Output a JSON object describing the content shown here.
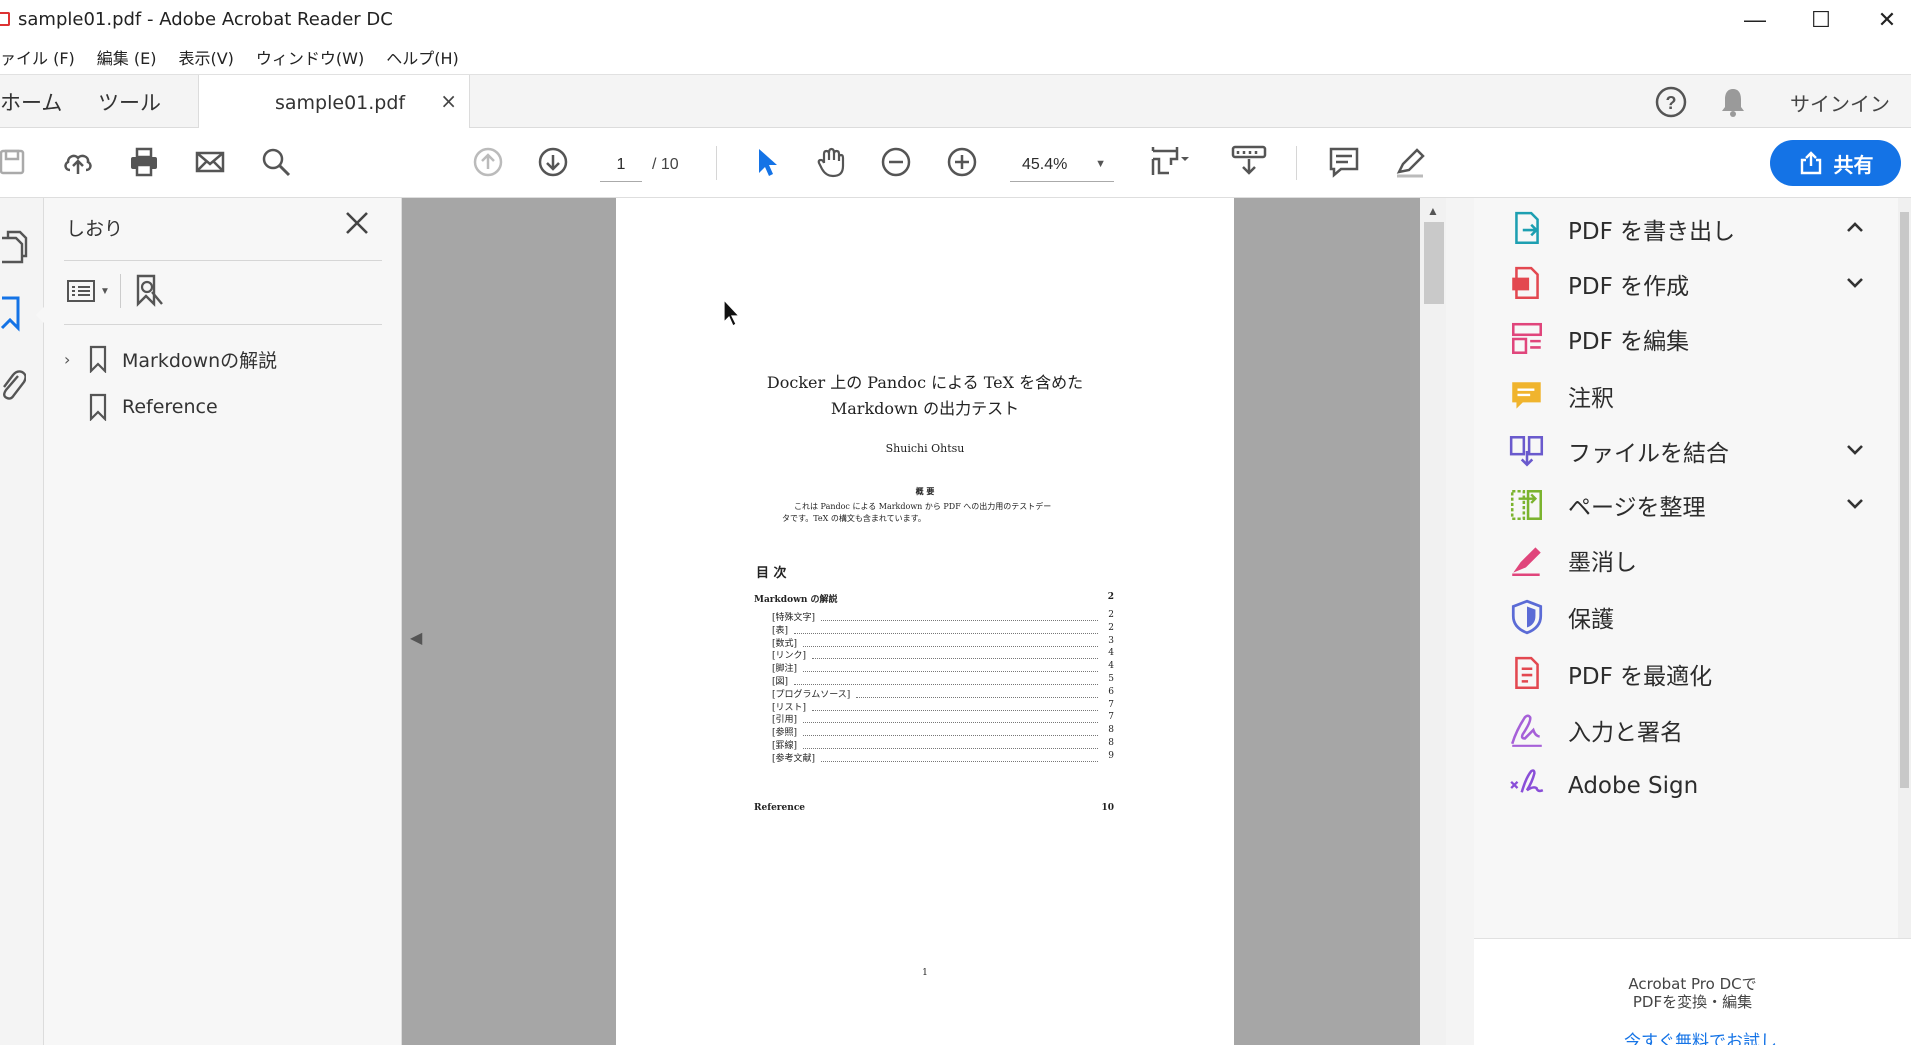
{
  "window": {
    "title": "sample01.pdf - Adobe Acrobat Reader DC",
    "minimize": "—",
    "maximize": "☐",
    "close": "✕"
  },
  "menu": [
    "ァイル (F)",
    "編集 (E)",
    "表示(V)",
    "ウィンドウ(W)",
    "ヘルプ(H)"
  ],
  "tabs": {
    "home": "ホーム",
    "tools": "ツール",
    "document": "sample01.pdf",
    "close": "×",
    "signin": "サインイン"
  },
  "toolbar": {
    "page_current": "1",
    "page_total": "/ 10",
    "zoom": "45.4%",
    "share_label": "共有"
  },
  "bookmarks": {
    "title": "しおり",
    "items": [
      {
        "label": "Markdownの解説",
        "expandable": true
      },
      {
        "label": "Reference",
        "expandable": false
      }
    ]
  },
  "pdf_page": {
    "title_line1": "Docker 上の Pandoc による TeX を含めた",
    "title_line2": "Markdown の出力テスト",
    "author": "Shuichi Ohtsu",
    "abstract_heading": "概 要",
    "abstract_line1": "これは Pandoc による Markdown から PDF への出力用のテストデー",
    "abstract_line2": "タです。TeX の構文も含まれています。",
    "toc_heading": "目 次",
    "toc_section": {
      "label": "Markdown の解説",
      "page": "2"
    },
    "toc_items": [
      {
        "label": "[特殊文字]",
        "page": "2"
      },
      {
        "label": "[表]",
        "page": "2"
      },
      {
        "label": "[数式]",
        "page": "3"
      },
      {
        "label": "[リンク]",
        "page": "4"
      },
      {
        "label": "[脚注]",
        "page": "4"
      },
      {
        "label": "[図]",
        "page": "5"
      },
      {
        "label": "[プログラムソース]",
        "page": "6"
      },
      {
        "label": "[リスト]",
        "page": "7"
      },
      {
        "label": "[引用]",
        "page": "7"
      },
      {
        "label": "[参照]",
        "page": "8"
      },
      {
        "label": "[罫線]",
        "page": "8"
      },
      {
        "label": "[参考文献]",
        "page": "9"
      }
    ],
    "toc_reference": {
      "label": "Reference",
      "page": "10"
    },
    "page_number": "1"
  },
  "tools_panel": [
    {
      "label": "PDF を書き出し",
      "icon": "export-pdf-icon",
      "color": "#1d9fb1",
      "chevron": "up"
    },
    {
      "label": "PDF を作成",
      "icon": "create-pdf-icon",
      "color": "#e34850",
      "chevron": "down"
    },
    {
      "label": "PDF を編集",
      "icon": "edit-pdf-icon",
      "color": "#e0457b",
      "chevron": ""
    },
    {
      "label": "注釈",
      "icon": "comment-icon",
      "color": "#f0b42d",
      "chevron": ""
    },
    {
      "label": "ファイルを結合",
      "icon": "combine-files-icon",
      "color": "#6a5acd",
      "chevron": "down"
    },
    {
      "label": "ページを整理",
      "icon": "organize-pages-icon",
      "color": "#7bb32e",
      "chevron": "down"
    },
    {
      "label": "墨消し",
      "icon": "redact-icon",
      "color": "#e0457b",
      "chevron": ""
    },
    {
      "label": "保護",
      "icon": "protect-icon",
      "color": "#5b6bd6",
      "chevron": ""
    },
    {
      "label": "PDF を最適化",
      "icon": "optimize-pdf-icon",
      "color": "#e34850",
      "chevron": ""
    },
    {
      "label": "入力と署名",
      "icon": "fill-sign-icon",
      "color": "#a660d8",
      "chevron": ""
    },
    {
      "label": "Adobe Sign",
      "icon": "adobe-sign-icon",
      "color": "#8a4fd8",
      "chevron": ""
    }
  ],
  "promo": {
    "line1": "Acrobat Pro DCで",
    "line2": "PDFを変換・編集",
    "link": "今すぐ無料でお試し"
  },
  "colors": {
    "accent": "#1473e6",
    "doc_background": "#a6a6a6"
  }
}
